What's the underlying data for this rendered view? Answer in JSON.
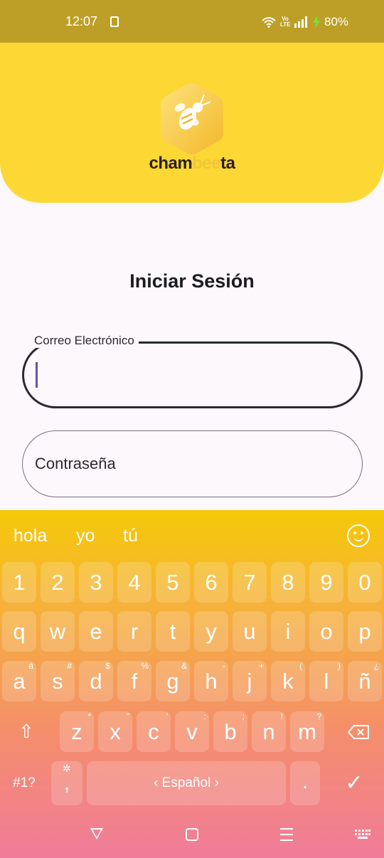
{
  "status_bar": {
    "time": "12:07",
    "volte_top": "Vo",
    "volte_bottom": "LTE",
    "battery": "80%"
  },
  "header": {
    "logo_text_a": "cham",
    "logo_text_b": "bee",
    "logo_text_c": "ta",
    "background_color": "#fdd835"
  },
  "login": {
    "title": "Iniciar Sesión",
    "email_label": "Correo Electrónico",
    "password_placeholder": "Contraseña"
  },
  "keyboard": {
    "suggestions": [
      "hola",
      "yo",
      "tú"
    ],
    "number_row": [
      "1",
      "2",
      "3",
      "4",
      "5",
      "6",
      "7",
      "8",
      "9",
      "0"
    ],
    "row1": [
      "q",
      "w",
      "e",
      "r",
      "t",
      "y",
      "u",
      "i",
      "o",
      "p"
    ],
    "row2": [
      {
        "k": "a",
        "h": "á"
      },
      {
        "k": "s",
        "h": "#"
      },
      {
        "k": "d",
        "h": "$"
      },
      {
        "k": "f",
        "h": "%"
      },
      {
        "k": "g",
        "h": "&"
      },
      {
        "k": "h",
        "h": "-"
      },
      {
        "k": "j",
        "h": "+"
      },
      {
        "k": "k",
        "h": "("
      },
      {
        "k": "l",
        "h": ")"
      },
      {
        "k": "ñ",
        "h": "¿"
      }
    ],
    "row3": [
      {
        "k": "z",
        "h": "*"
      },
      {
        "k": "x",
        "h": "\""
      },
      {
        "k": "c",
        "h": "'"
      },
      {
        "k": "v",
        "h": ":"
      },
      {
        "k": "b",
        "h": ";"
      },
      {
        "k": "n",
        "h": "!"
      },
      {
        "k": "m",
        "h": "?"
      }
    ],
    "shift_symbol": "⇧",
    "symbols_label": "#1?",
    "comma": ",",
    "comma_hint": "✲",
    "space_label": "‹  Español  ›",
    "period": ".",
    "enter_symbol": "✓"
  }
}
